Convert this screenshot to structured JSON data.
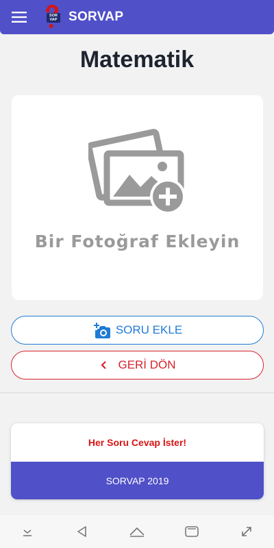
{
  "appbar": {
    "title": "SORVAP",
    "menu_icon": "hamburger-menu-icon",
    "logo_text": "SOR VAP",
    "color": "#5050c9"
  },
  "page": {
    "title": "Matematik"
  },
  "photo_card": {
    "label": "Bir Fotoğraf Ekleyin",
    "icon": "add-photo-icon"
  },
  "buttons": {
    "add_question": {
      "label": "SORU EKLE",
      "icon": "add-camera-icon",
      "color": "#1f7bd6"
    },
    "back": {
      "label": "GERİ DÖN",
      "icon": "chevron-left-icon",
      "color": "#d6232e"
    }
  },
  "footer": {
    "slogan": "Her Soru Cevap İster!",
    "copyright": "SORVAP 2019"
  },
  "system_nav": [
    "hide-keyboard-icon",
    "back-icon",
    "home-icon",
    "recents-icon",
    "rotate-screen-icon"
  ]
}
